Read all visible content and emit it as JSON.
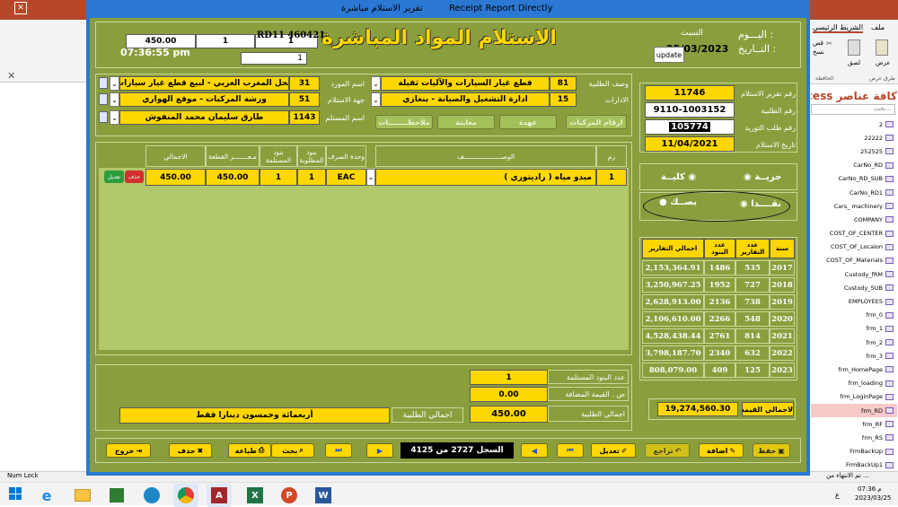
{
  "access_bg": {
    "title_right": "كافة عناصر Access",
    "search_placeholder": "بحث...",
    "ribbon_tabs": [
      "ملف",
      "الشريط الرئيسي"
    ],
    "ribbon_labels": [
      "طرق عرض",
      "الحافظة"
    ],
    "clip": [
      "قص",
      "نسخ",
      "لصق",
      "عرض"
    ],
    "nav_items": [
      "2",
      "22222",
      "252525",
      "CarNo_RD",
      "CarNo_RD_SUB",
      "CarNo_RD1",
      "Cars_ machinery",
      "COMPANY",
      "COST_OF_CENTER",
      "COST_OF_Locaion",
      "COST_OF_Materials",
      "Custody_fRM",
      "Custody_SUB",
      "EMPLOYEES",
      "frm_0",
      "frm_1",
      "frm_2",
      "frm_3",
      "frm_HomePage",
      "frm_loading",
      "frm_LoginPage",
      "frm_RD",
      "frm_RF",
      "frm_RS",
      "FrmBackUp",
      "FrmBackUp1"
    ],
    "status_left": "Num Lock",
    "status_right": "تم الانتهاء من ...",
    "clock_time": "07:36 م",
    "clock_date": "2023/03/25",
    "clock_lang": "ع"
  },
  "window": {
    "title": "Receipt Report Directly",
    "title_ar": "تقرير الاستلام مباشرة"
  },
  "header": {
    "main_title": "الاستلام المواد المباشرة",
    "total": "450.00",
    "count": "1",
    "rd_code": "RD11 460421",
    "rd_num": "1",
    "time": "07:36:55 pm",
    "small_input": "1",
    "day_label": "اليـــوم :",
    "day_value": "السبت",
    "date_label": "التــاريخ :",
    "date_value": "25/03/2023",
    "update_btn": "update"
  },
  "form": {
    "l1_label": "وصف الطلبية",
    "l1_code": "81",
    "l1_value": "قطع غيار السيارات والآليات ثقيلة",
    "l2_label": "الادارات",
    "l2_code": "15",
    "l2_value": "ادارة التشغيل والصيانة - بنغازي",
    "r1_label": "اسم المورد",
    "r1_code": "31",
    "r1_value": "محل المغرب العربي - لبيع قطع غيار سيارات",
    "r2_label": "جهة الاستلام",
    "r2_code": "51",
    "r2_value": "ورشة المركبات - موقع الهواري",
    "r3_label": "اسم المستلم",
    "r3_code": "1143",
    "r3_value": "طارق سليمان محمد المنفوش",
    "btn_cars": "ارقام المركبات",
    "btn_equip": "عهدة",
    "btn_inspect": "معاينة",
    "btn_notes": "ملاحظــــــــات"
  },
  "grid": {
    "headers": [
      "رم",
      "الوصـــــــــــــــــــف",
      "وحدة الصرف",
      "بنود المطلوبة",
      "بنود المستلمة",
      "مـعـــــــر القطعة",
      "الاجمالي"
    ],
    "row": {
      "no": "1",
      "desc": "ميدو مياه ( راديتوري )",
      "unit": "EAC",
      "req": "1",
      "recv": "1",
      "price": "450.00",
      "total": "450.00"
    },
    "edit_btn": "تعديل",
    "del_btn": "حذف"
  },
  "summary": {
    "items_label": "عدد البنود المستلمة",
    "items_value": "1",
    "vat_label": "ض . القيمة المضافة",
    "vat_value": "0.00",
    "order_total_label": "اجمالي الطلبية",
    "order_total_value": "450.00",
    "total_label": "اجمالي الطلبية",
    "words": "أربعمائة وخمسون دينارا فقط"
  },
  "info": {
    "report_no_label": "رقم تقرير الاستلام",
    "report_no": "11746",
    "order_no_label": "رقم الطلبية",
    "order_no": "9110-1003152",
    "supply_label": "رقم طلب التوريد",
    "supply_no": "105774",
    "recv_date_label": "تاريخ الاستلام",
    "recv_date": "11/04/2021"
  },
  "radios": {
    "partial": "جزيــة",
    "total": "كليــة",
    "cash": "نقــــدا",
    "cheque": "بصــك"
  },
  "stats": {
    "headers": [
      "سنة",
      "عدد التقارير",
      "عدد البنود",
      "اجمالي التقارير"
    ],
    "rows": [
      [
        "2017",
        "535",
        "1486",
        "2,153,364.91"
      ],
      [
        "2018",
        "727",
        "1952",
        "3,250,967.25"
      ],
      [
        "2019",
        "738",
        "2136",
        "2,628,913.00"
      ],
      [
        "2020",
        "548",
        "2266",
        "2,106,610.00"
      ],
      [
        "2021",
        "814",
        "2761",
        "4,528,438.44"
      ],
      [
        "2022",
        "632",
        "2340",
        "3,798,187.70"
      ],
      [
        "2023",
        "125",
        "409",
        "808,079.00"
      ]
    ],
    "grand_label": "الاجمالي القيمة",
    "grand_value": "19,274,560.30"
  },
  "footer": {
    "save": "حفظ",
    "add": "اضافة",
    "undo": "تراجع",
    "edit": "تعديل",
    "record": "السجل 2727 من 4125",
    "search": "بحث",
    "print": "طباعة",
    "delete": "حذف",
    "exit": "خروج"
  },
  "colors": {
    "olive": "#8b9e3e",
    "panel": "#b2c96b",
    "yellow": "#ffd700",
    "frame": "#2a78d4"
  }
}
